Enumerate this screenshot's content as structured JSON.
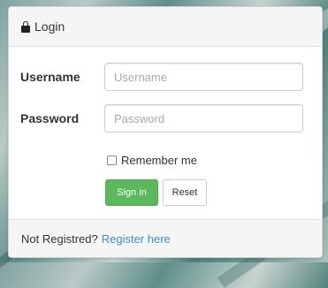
{
  "panel": {
    "heading": "Login",
    "heading_icon": "lock-icon"
  },
  "form": {
    "username_label": "Username",
    "username_placeholder": "Username",
    "username_value": "",
    "password_label": "Password",
    "password_placeholder": "Password",
    "password_value": "",
    "remember_label": "Remember me",
    "remember_checked": false,
    "signin_label": "Sign in",
    "reset_label": "Reset"
  },
  "footer": {
    "text": "Not Registred?",
    "link": "Register here"
  },
  "colors": {
    "success": "#5cb85c",
    "link": "#428bca"
  }
}
